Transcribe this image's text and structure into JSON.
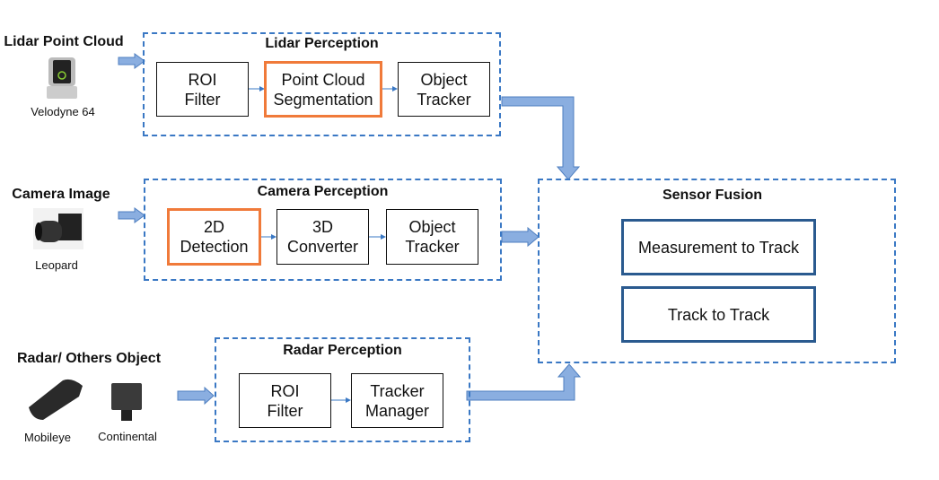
{
  "sources": {
    "lidar": {
      "title": "Lidar Point Cloud",
      "device": "Velodyne 64",
      "icon": "lidar-sensor-icon"
    },
    "camera": {
      "title": "Camera Image",
      "device": "Leopard",
      "icon": "camera-icon"
    },
    "radar": {
      "title": "Radar/ Others Object",
      "devices": [
        "Mobileye",
        "Continental"
      ],
      "icons": [
        "mobileye-sensor-icon",
        "radar-sensor-icon"
      ]
    }
  },
  "lidar_perception": {
    "title": "Lidar Perception",
    "steps": [
      "ROI\nFilter",
      "Point Cloud\nSegmentation",
      "Object\nTracker"
    ],
    "highlighted": [
      "Point Cloud\nSegmentation"
    ]
  },
  "camera_perception": {
    "title": "Camera Perception",
    "steps": [
      "2D\nDetection",
      "3D\nConverter",
      "Object\nTracker"
    ],
    "highlighted": [
      "2D\nDetection"
    ]
  },
  "radar_perception": {
    "title": "Radar Perception",
    "steps": [
      "ROI\nFilter",
      "Tracker\nManager"
    ]
  },
  "sensor_fusion": {
    "title": "Sensor Fusion",
    "steps": [
      "Measurement to Track",
      "Track to Track"
    ]
  },
  "colors": {
    "group_border": "#3a78c4",
    "highlight": "#f07a3a",
    "fusion_box": "#2a5a8f",
    "arrow_fill": "#8aaee0"
  }
}
